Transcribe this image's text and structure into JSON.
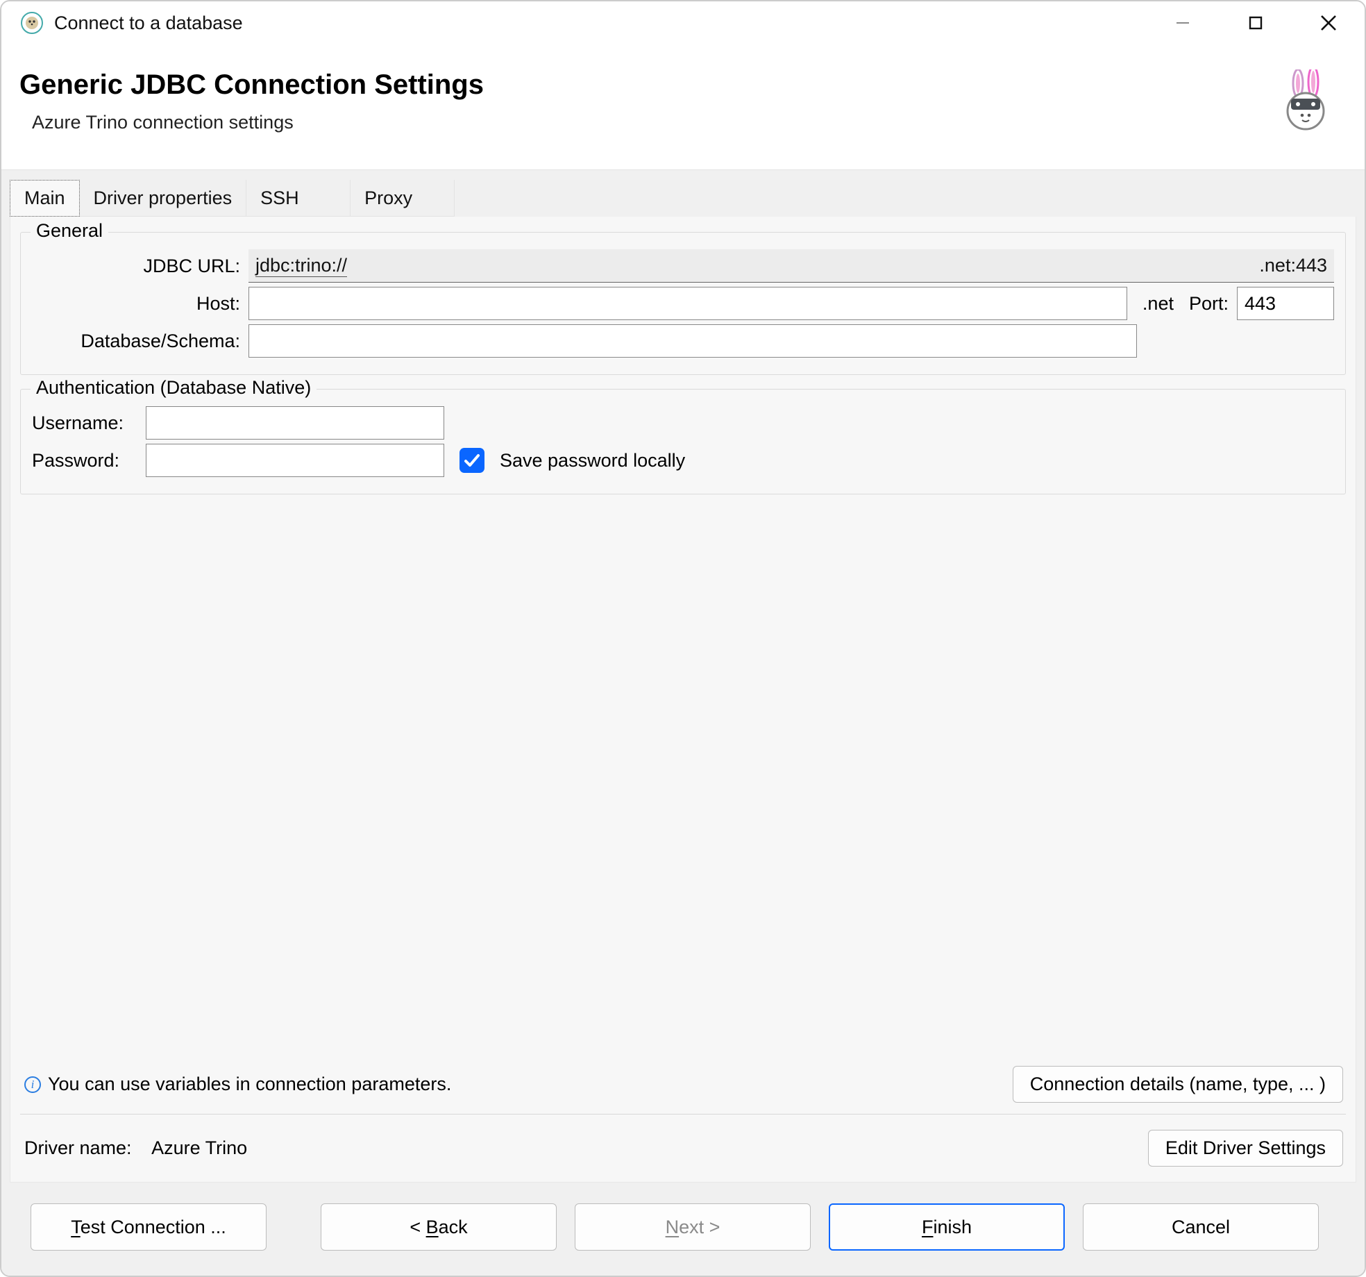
{
  "window": {
    "title": "Connect to a database"
  },
  "header": {
    "title": "Generic JDBC Connection Settings",
    "subtitle": "Azure Trino connection settings"
  },
  "tabs": {
    "items": [
      {
        "label": "Main"
      },
      {
        "label": "Driver properties"
      },
      {
        "label": "SSH"
      },
      {
        "label": "Proxy"
      }
    ],
    "active_index": 0
  },
  "general": {
    "title": "General",
    "jdbc_label": "JDBC URL:",
    "jdbc_left": "jdbc:trino://",
    "jdbc_right": ".net:443",
    "host_label": "Host:",
    "host_value": "",
    "host_suffix": ".net",
    "port_label": "Port:",
    "port_value": "443",
    "dbschema_label": "Database/Schema:",
    "dbschema_value": ""
  },
  "auth": {
    "title": "Authentication (Database Native)",
    "username_label": "Username:",
    "username_value": "",
    "password_label": "Password:",
    "password_value": "",
    "save_password_checked": true,
    "save_password_label": "Save password locally"
  },
  "info": {
    "hint": "You can use variables in connection parameters.",
    "connection_details_btn": "Connection details (name, type, ... )"
  },
  "driver": {
    "label": "Driver name:",
    "name": "Azure Trino",
    "edit_btn": "Edit Driver Settings"
  },
  "footer": {
    "test_connection": "Test Connection ...",
    "back": "< Back",
    "next": "Next >",
    "finish": "Finish",
    "cancel": "Cancel"
  }
}
